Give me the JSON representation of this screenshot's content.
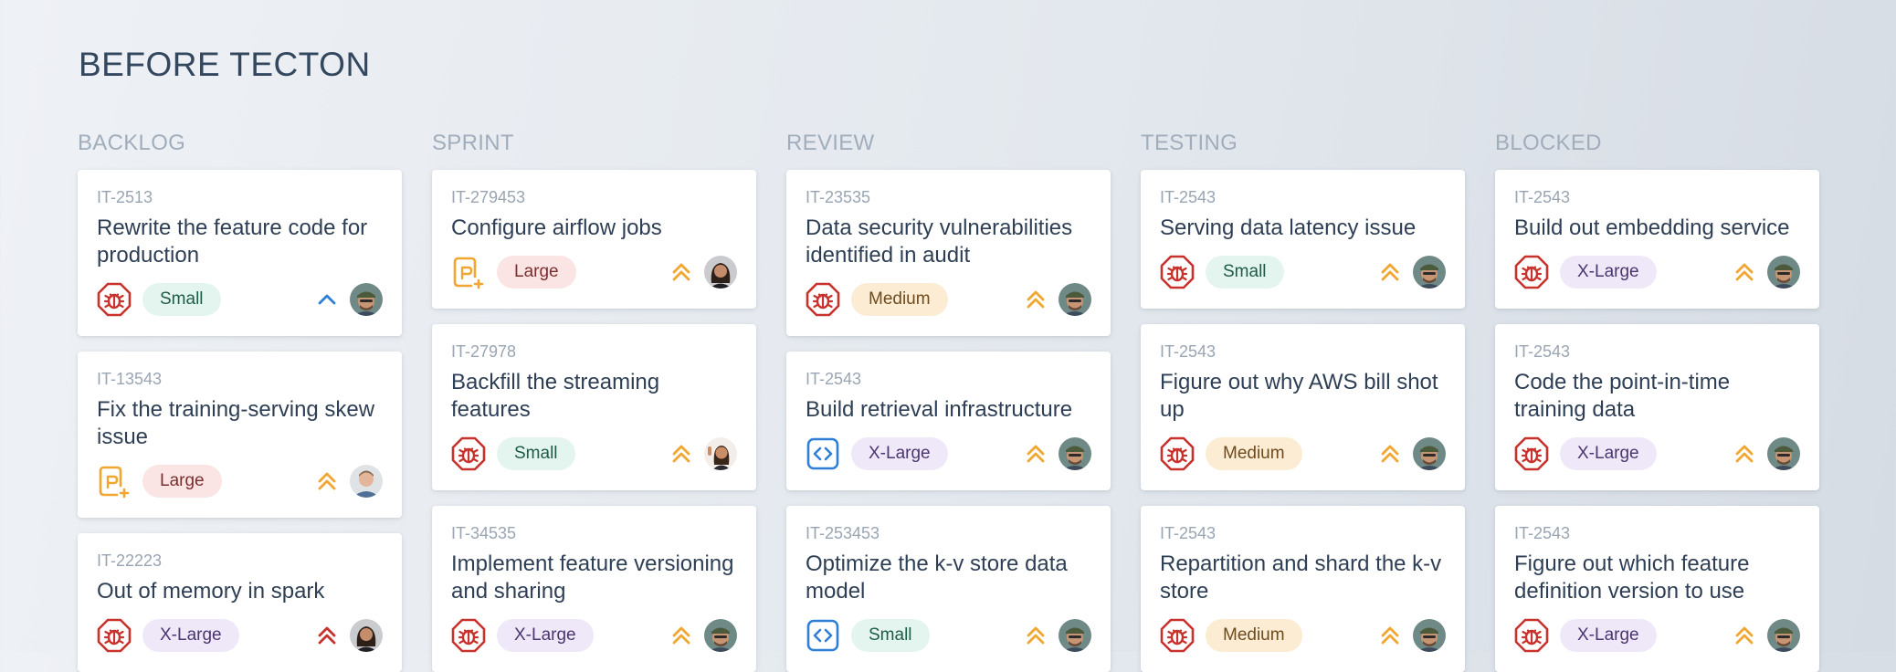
{
  "page": {
    "title": "BEFORE TECTON"
  },
  "columns": [
    {
      "title": "BACKLOG",
      "cards": [
        {
          "id": "IT-2513",
          "title": "Rewrite the feature code for production",
          "type": "bug-icon",
          "size": "Small",
          "priority": "chevron-up-icon",
          "avatar": "avatar-man-cap"
        },
        {
          "id": "IT-13543",
          "title": "Fix the training-serving skew issue",
          "type": "feature-request-icon",
          "size": "Large",
          "priority": "double-chevron-up-icon",
          "avatar": "avatar-man-light"
        },
        {
          "id": "IT-22223",
          "title": "Out of memory in spark",
          "type": "bug-icon",
          "size": "X-Large",
          "priority": "double-chevron-up-icon",
          "avatar": "avatar-woman"
        }
      ]
    },
    {
      "title": "SPRINT",
      "cards": [
        {
          "id": "IT-279453",
          "title": "Configure airflow jobs",
          "type": "feature-request-icon",
          "size": "Large",
          "priority": "double-chevron-up-icon",
          "avatar": "avatar-woman"
        },
        {
          "id": "IT-27978",
          "title": "Backfill the streaming features",
          "type": "bug-icon",
          "size": "Small",
          "priority": "double-chevron-up-icon",
          "avatar": "avatar-woman-waving"
        },
        {
          "id": "IT-34535",
          "title": "Implement feature versioning and sharing",
          "type": "bug-icon",
          "size": "X-Large",
          "priority": "double-chevron-up-icon",
          "avatar": "avatar-man-cap"
        }
      ]
    },
    {
      "title": "REVIEW",
      "cards": [
        {
          "id": "IT-23535",
          "title": "Data security vulnerabilities identified in audit",
          "type": "bug-icon",
          "size": "Medium",
          "priority": "double-chevron-up-icon",
          "avatar": "avatar-man-cap"
        },
        {
          "id": "IT-2543",
          "title": "Build retrieval infrastructure",
          "type": "code-icon",
          "size": "X-Large",
          "priority": "double-chevron-up-icon",
          "avatar": "avatar-man-cap"
        },
        {
          "id": "IT-253453",
          "title": "Optimize the k-v store data model",
          "type": "code-icon",
          "size": "Small",
          "priority": "double-chevron-up-icon",
          "avatar": "avatar-man-cap"
        }
      ]
    },
    {
      "title": "TESTING",
      "cards": [
        {
          "id": "IT-2543",
          "title": "Serving data latency issue",
          "type": "bug-icon",
          "size": "Small",
          "priority": "double-chevron-up-icon",
          "avatar": "avatar-man-cap"
        },
        {
          "id": "IT-2543",
          "title": "Figure out why AWS bill shot up",
          "type": "bug-icon",
          "size": "Medium",
          "priority": "double-chevron-up-icon",
          "avatar": "avatar-man-cap"
        },
        {
          "id": "IT-2543",
          "title": "Repartition and shard the k-v store",
          "type": "bug-icon",
          "size": "Medium",
          "priority": "double-chevron-up-icon",
          "avatar": "avatar-man-cap"
        }
      ]
    },
    {
      "title": "BLOCKED",
      "cards": [
        {
          "id": "IT-2543",
          "title": "Build out embedding service",
          "type": "bug-icon",
          "size": "X-Large",
          "priority": "double-chevron-up-icon",
          "avatar": "avatar-man-cap"
        },
        {
          "id": "IT-2543",
          "title": "Code the point-in-time training data",
          "type": "bug-icon",
          "size": "X-Large",
          "priority": "double-chevron-up-icon",
          "avatar": "avatar-man-cap"
        },
        {
          "id": "IT-2543",
          "title": "Figure out which feature definition version to use",
          "type": "bug-icon",
          "size": "X-Large",
          "priority": "double-chevron-up-icon",
          "avatar": "avatar-man-cap"
        }
      ]
    }
  ],
  "colors": {
    "bug": "#c8322d",
    "feature": "#f0a630",
    "code": "#2f7fd6",
    "priority_high": "#f0a630",
    "priority_critical": "#c8322d",
    "priority_low": "#2f7fd6"
  }
}
